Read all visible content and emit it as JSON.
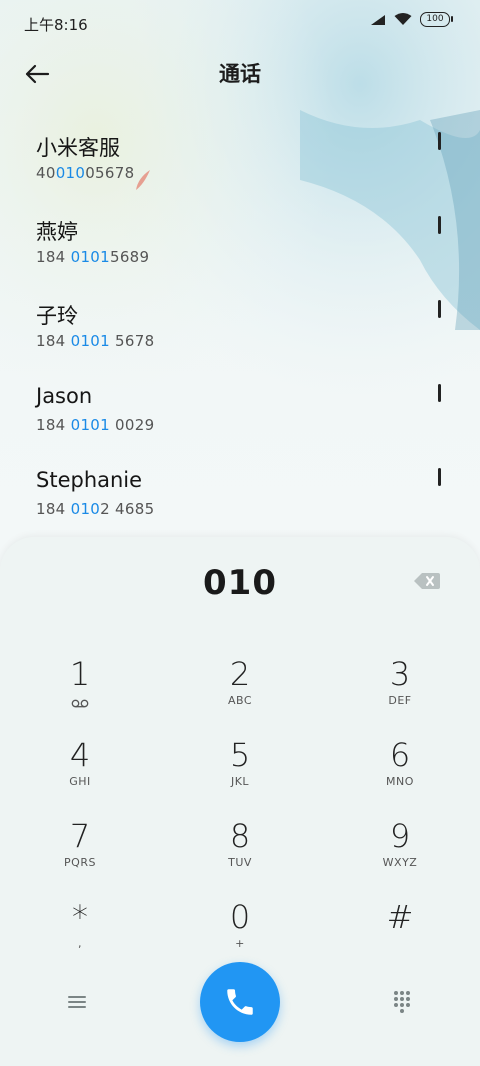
{
  "status_bar": {
    "time": "上午8:16",
    "battery": "100"
  },
  "header": {
    "title": "通话"
  },
  "contacts": [
    {
      "name": "小米客服",
      "number_pre": "40",
      "number_match": "010",
      "number_post": "05678"
    },
    {
      "name": "燕婷",
      "number_pre": "184 ",
      "number_match": "0101",
      "number_post": "5689"
    },
    {
      "name": "子玲",
      "number_pre": "184 ",
      "number_match": "0101",
      "number_post": " 5678"
    },
    {
      "name": "Jason",
      "number_pre": "184 ",
      "number_match": "0101",
      "number_post": " 0029"
    },
    {
      "name": "Stephanie",
      "number_pre": "184 ",
      "number_match": "010",
      "number_post": "2 4685"
    }
  ],
  "dialpad": {
    "input_value": "010",
    "keys": [
      {
        "digit": "1",
        "letters": ""
      },
      {
        "digit": "2",
        "letters": "ABC"
      },
      {
        "digit": "3",
        "letters": "DEF"
      },
      {
        "digit": "4",
        "letters": "GHI"
      },
      {
        "digit": "5",
        "letters": "JKL"
      },
      {
        "digit": "6",
        "letters": "MNO"
      },
      {
        "digit": "7",
        "letters": "PQRS"
      },
      {
        "digit": "8",
        "letters": "TUV"
      },
      {
        "digit": "9",
        "letters": "WXYZ"
      },
      {
        "digit": "*",
        "letters": ","
      },
      {
        "digit": "0",
        "letters": "+"
      },
      {
        "digit": "#",
        "letters": ""
      }
    ]
  },
  "colors": {
    "accent": "#2196f3",
    "highlight": "#1a8ae6"
  },
  "icons": [
    "back-arrow-icon",
    "signal-icon",
    "wifi-icon",
    "battery-icon",
    "backspace-icon",
    "voicemail-icon",
    "menu-icon",
    "phone-icon",
    "keypad-icon"
  ]
}
